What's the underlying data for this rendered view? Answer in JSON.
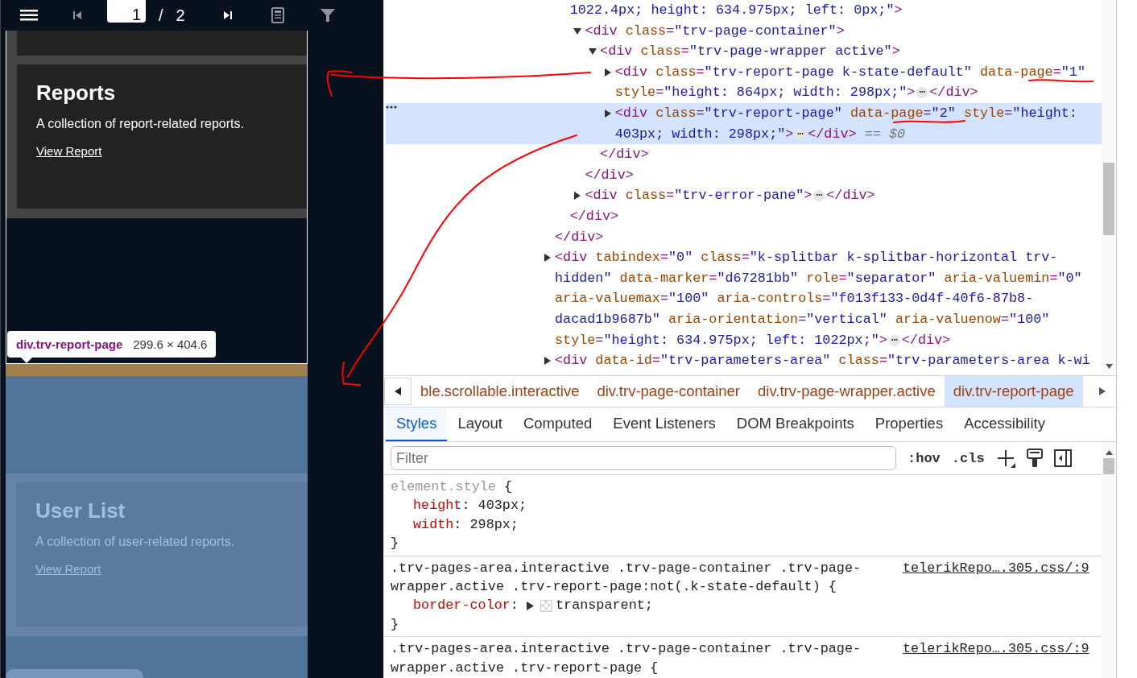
{
  "viewer": {
    "toolbar": {
      "page_input": "1",
      "separator": "/",
      "page_count": "2"
    },
    "pages": [
      {
        "title": "Reports",
        "description": "A collection of report-related reports.",
        "link": "View Report",
        "highlighted": false
      },
      {
        "title": "User List",
        "description": "A collection of user-related reports.",
        "link": "View Report",
        "highlighted": true
      }
    ],
    "inspect_tooltip": {
      "selector": "div.trv-report-page",
      "size": "299.6 × 404.6"
    }
  },
  "devtools": {
    "dom_tree": [
      {
        "close": "</div>",
        "children": [
          {
            "selected": false,
            "parts": [
              {
                "kind": "value",
                "text": "1022.4px; height: 634.975px; left: 0px;\""
              },
              {
                "kind": "tag",
                "text": ">"
              }
            ],
            "close": "</div>",
            "children": [
              {
                "selected": false,
                "expanded": true,
                "parts": [
                  {
                    "kind": "tag",
                    "text": "<div"
                  },
                  {
                    "kind": "name",
                    "text": " class"
                  },
                  {
                    "kind": "punct",
                    "text": "="
                  },
                  {
                    "kind": "value",
                    "text": "\"trv-page-container\""
                  },
                  {
                    "kind": "tag",
                    "text": ">"
                  }
                ],
                "close": "</div>",
                "children": [
                  {
                    "selected": false,
                    "expanded": true,
                    "parts": [
                      {
                        "kind": "tag",
                        "text": "<div"
                      },
                      {
                        "kind": "name",
                        "text": " class"
                      },
                      {
                        "kind": "punct",
                        "text": "="
                      },
                      {
                        "kind": "value",
                        "text": "\"trv-page-wrapper active\""
                      },
                      {
                        "kind": "tag",
                        "text": ">"
                      }
                    ],
                    "close": "</div>",
                    "children": [
                      {
                        "selected": false,
                        "expanded": false,
                        "parts": [
                          {
                            "kind": "tag",
                            "text": "<div"
                          },
                          {
                            "kind": "name",
                            "text": " class"
                          },
                          {
                            "kind": "punct",
                            "text": "="
                          },
                          {
                            "kind": "value",
                            "text": "\"trv-report-page k-state-default\""
                          },
                          {
                            "kind": "name",
                            "text": " data-page"
                          },
                          {
                            "kind": "punct",
                            "text": "="
                          },
                          {
                            "kind": "value",
                            "text": "\"1\""
                          },
                          {
                            "kind": "name",
                            "text": " style"
                          },
                          {
                            "kind": "punct",
                            "text": "="
                          },
                          {
                            "kind": "value",
                            "text": "\"height: 864px; width: 298px;\""
                          },
                          {
                            "kind": "tag",
                            "text": ">"
                          },
                          {
                            "kind": "more",
                            "text": "⋯"
                          },
                          {
                            "kind": "tag",
                            "text": "</div>"
                          }
                        ]
                      },
                      {
                        "selected": true,
                        "expanded": false,
                        "parts": [
                          {
                            "kind": "tag",
                            "text": "<div"
                          },
                          {
                            "kind": "name",
                            "text": " class"
                          },
                          {
                            "kind": "punct",
                            "text": "="
                          },
                          {
                            "kind": "value",
                            "text": "\"trv-report-page\""
                          },
                          {
                            "kind": "name",
                            "text": " data-page"
                          },
                          {
                            "kind": "punct",
                            "text": "="
                          },
                          {
                            "kind": "value",
                            "text": "\"2\""
                          },
                          {
                            "kind": "name",
                            "text": " style"
                          },
                          {
                            "kind": "punct",
                            "text": "="
                          },
                          {
                            "kind": "value",
                            "text": "\"height: 403px; width: 298px;\""
                          },
                          {
                            "kind": "tag",
                            "text": ">"
                          },
                          {
                            "kind": "more",
                            "text": "⋯"
                          },
                          {
                            "kind": "tag",
                            "text": "</div>"
                          },
                          {
                            "kind": "hint",
                            "text": " == $0"
                          }
                        ]
                      }
                    ]
                  }
                ]
              },
              {
                "selected": false,
                "expanded": false,
                "parts": [
                  {
                    "kind": "tag",
                    "text": "<div"
                  },
                  {
                    "kind": "name",
                    "text": " class"
                  },
                  {
                    "kind": "punct",
                    "text": "="
                  },
                  {
                    "kind": "value",
                    "text": "\"trv-error-pane\""
                  },
                  {
                    "kind": "tag",
                    "text": ">"
                  },
                  {
                    "kind": "more",
                    "text": "⋯"
                  },
                  {
                    "kind": "tag",
                    "text": "</div>"
                  }
                ]
              }
            ]
          }
        ]
      },
      {
        "selected": false,
        "expanded": false,
        "parts": [
          {
            "kind": "tag",
            "text": "<div"
          },
          {
            "kind": "name",
            "text": " tabindex"
          },
          {
            "kind": "punct",
            "text": "="
          },
          {
            "kind": "value",
            "text": "\"0\""
          },
          {
            "kind": "name",
            "text": " class"
          },
          {
            "kind": "punct",
            "text": "="
          },
          {
            "kind": "value",
            "text": "\"k-splitbar k-splitbar-horizontal trv-hidden\""
          },
          {
            "kind": "name",
            "text": " data-marker"
          },
          {
            "kind": "punct",
            "text": "="
          },
          {
            "kind": "value",
            "text": "\"d67281bb\""
          },
          {
            "kind": "name",
            "text": " role"
          },
          {
            "kind": "punct",
            "text": "="
          },
          {
            "kind": "value",
            "text": "\"separator\""
          },
          {
            "kind": "name",
            "text": " aria-valuemin"
          },
          {
            "kind": "punct",
            "text": "="
          },
          {
            "kind": "value",
            "text": "\"0\""
          },
          {
            "kind": "name",
            "text": " aria-valuemax"
          },
          {
            "kind": "punct",
            "text": "="
          },
          {
            "kind": "value",
            "text": "\"100\""
          },
          {
            "kind": "name",
            "text": " aria-controls"
          },
          {
            "kind": "punct",
            "text": "="
          },
          {
            "kind": "value",
            "text": "\"f013f133-0d4f-40f6-87b8-dacad1b9687b\""
          },
          {
            "kind": "name",
            "text": " aria-orientation"
          },
          {
            "kind": "punct",
            "text": "="
          },
          {
            "kind": "value",
            "text": "\"vertical\""
          },
          {
            "kind": "name",
            "text": " aria-valuenow"
          },
          {
            "kind": "punct",
            "text": "="
          },
          {
            "kind": "value",
            "text": "\"100\""
          },
          {
            "kind": "name",
            "text": " style"
          },
          {
            "kind": "punct",
            "text": "="
          },
          {
            "kind": "value",
            "text": "\"height: 634.975px; left: 1022px;\""
          },
          {
            "kind": "tag",
            "text": ">"
          },
          {
            "kind": "more",
            "text": "⋯"
          },
          {
            "kind": "tag",
            "text": "</div>"
          }
        ]
      },
      {
        "selected": false,
        "expanded": false,
        "parts": [
          {
            "kind": "tag",
            "text": "<div"
          },
          {
            "kind": "name",
            "text": " data-id"
          },
          {
            "kind": "punct",
            "text": "="
          },
          {
            "kind": "value",
            "text": "\"trv-parameters-area\""
          },
          {
            "kind": "name",
            "text": " class"
          },
          {
            "kind": "punct",
            "text": "="
          },
          {
            "kind": "value",
            "text": "\"trv-parameters-area k-wi"
          }
        ]
      }
    ],
    "breadcrumbs": [
      {
        "label": "ble.scrollable.interactive",
        "selected": false
      },
      {
        "label": "div.trv-page-container",
        "selected": false
      },
      {
        "label": "div.trv-page-wrapper.active",
        "selected": false
      },
      {
        "label": "div.trv-report-page",
        "selected": true
      }
    ],
    "tabs": [
      {
        "label": "Styles",
        "selected": true
      },
      {
        "label": "Layout",
        "selected": false
      },
      {
        "label": "Computed",
        "selected": false
      },
      {
        "label": "Event Listeners",
        "selected": false
      },
      {
        "label": "DOM Breakpoints",
        "selected": false
      },
      {
        "label": "Properties",
        "selected": false
      },
      {
        "label": "Accessibility",
        "selected": false
      }
    ],
    "filter": {
      "placeholder": "Filter"
    },
    "filter_toggles": [
      ":hov",
      ".cls"
    ],
    "style_rules": [
      {
        "kind": "inline",
        "selector": "element.style",
        "open": "{",
        "close": "}",
        "declarations": [
          {
            "property": "height",
            "separator": ":",
            "value": "403px;"
          },
          {
            "property": "width",
            "separator": ":",
            "value": "298px;"
          }
        ]
      },
      {
        "kind": "stylesheet",
        "selector": ".trv-pages-area.interactive .trv-page-container .trv-page-wrapper.active .trv-report-page:not(.k-state-default)",
        "open": "{",
        "close": "}",
        "source": "telerikRepo….305.css/:9",
        "declarations": [
          {
            "property": "border-color",
            "separator": ":",
            "value": "transparent;",
            "swatch": true
          }
        ]
      },
      {
        "kind": "stylesheet",
        "selector": ".trv-pages-area.interactive .trv-page-container .trv-page-wrapper.active .trv-report-page",
        "open": "{",
        "source": "telerikRepo….305.css/:9"
      }
    ]
  }
}
